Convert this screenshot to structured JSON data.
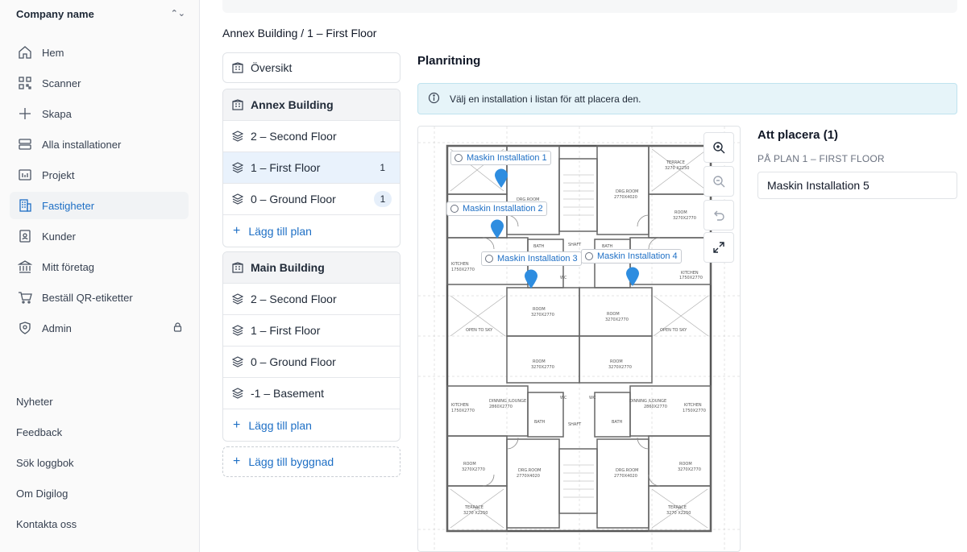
{
  "sidebar": {
    "company": "Company name",
    "nav": [
      {
        "label": "Hem",
        "icon": "home-icon"
      },
      {
        "label": "Scanner",
        "icon": "qr-icon"
      },
      {
        "label": "Skapa",
        "icon": "plus-icon"
      },
      {
        "label": "Alla installationer",
        "icon": "list-icon"
      },
      {
        "label": "Projekt",
        "icon": "folder-icon"
      },
      {
        "label": "Fastigheter",
        "icon": "building-icon",
        "active": true
      },
      {
        "label": "Kunder",
        "icon": "contact-icon"
      },
      {
        "label": "Mitt företag",
        "icon": "bank-icon"
      },
      {
        "label": "Beställ QR-etiketter",
        "icon": "cart-icon"
      },
      {
        "label": "Admin",
        "icon": "shield-icon",
        "locked": true
      }
    ],
    "footer": [
      "Nyheter",
      "Feedback",
      "Sök loggbok",
      "Om Digilog",
      "Kontakta oss"
    ]
  },
  "breadcrumb": "Annex Building / 1 – First Floor",
  "buildings": {
    "overview": "Översikt",
    "annex": {
      "name": "Annex Building",
      "floors": [
        {
          "label": "2 – Second Floor",
          "count": ""
        },
        {
          "label": "1 – First Floor",
          "count": "1"
        },
        {
          "label": "0 – Ground Floor",
          "count": "1"
        }
      ],
      "add_plan": "Lägg till plan"
    },
    "main": {
      "name": "Main Building",
      "floors": [
        {
          "label": "2 – Second Floor"
        },
        {
          "label": "1 – First Floor"
        },
        {
          "label": "0 – Ground Floor"
        },
        {
          "label": "-1 – Basement"
        }
      ],
      "add_plan": "Lägg till plan"
    },
    "add_building": "Lägg till byggnad"
  },
  "main": {
    "title": "Planritning",
    "alert": "Välj en installation i listan för att placera den.",
    "markers": [
      "Maskin Installation 1",
      "Maskin Installation 2",
      "Maskin Installation 3",
      "Maskin Installation 4"
    ],
    "plan_labels": {
      "terrace_l": "TERRACE",
      "terrace_l_size": "3270 X2250",
      "terrace_r": "TERRACE",
      "terrace_r_size": "3270 X2250",
      "drg_room": "DRG.ROOM",
      "drg_room_size": "2770X4020",
      "room": "ROOM",
      "room_size": "3270X2770",
      "kitchen": "KITCHEN",
      "kitchen_size": "1750X2770",
      "dining": "DINNING /LOUNGE",
      "dining_size": "2860X2770",
      "bath": "BATH",
      "shaft": "SHAFT",
      "wc": "WC",
      "open_sky": "OPEN TO SKY"
    },
    "pin_color": "#2e8de0"
  },
  "placement": {
    "title": "Att placera (1)",
    "subtitle": "PÅ PLAN 1 – FIRST FLOOR",
    "items": [
      "Maskin Installation 5"
    ]
  }
}
